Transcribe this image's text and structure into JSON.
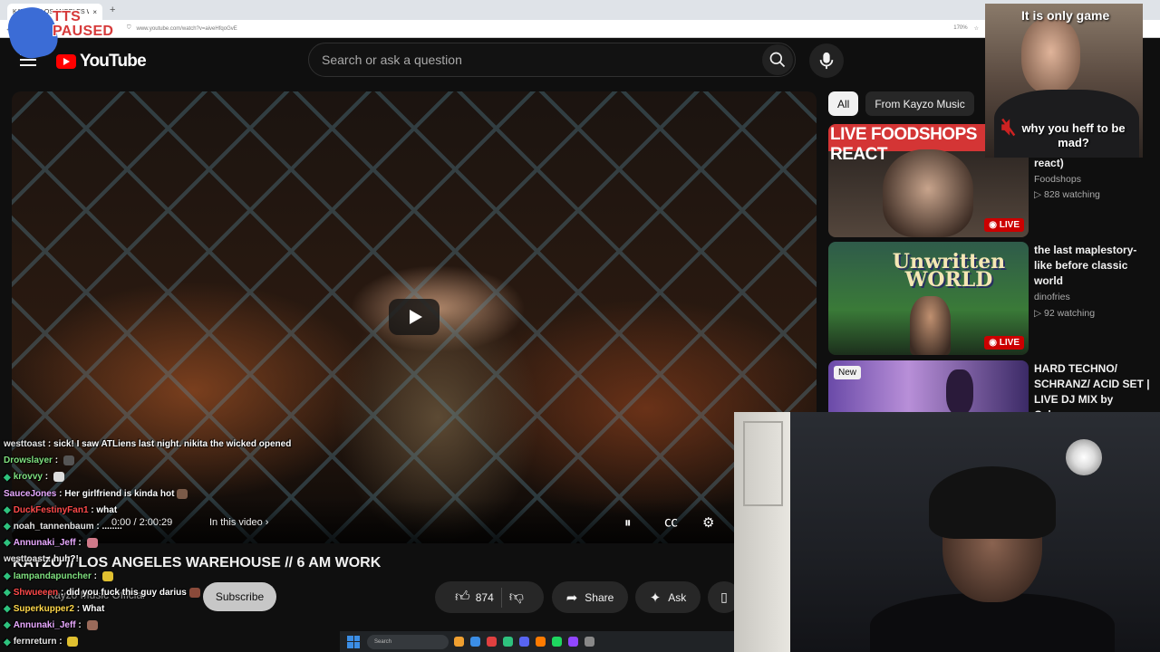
{
  "browser": {
    "tab_title": "KAYZO // LOS ANGELES WAREHOUSE",
    "tab_close": "×",
    "new_tab": "+",
    "url": "www.youtube.com/watch?v=aiveHfqoGvE",
    "zoom": "170%"
  },
  "tts": {
    "label_line1": "TTS",
    "label_line2": "PAUSED"
  },
  "header": {
    "logo_text": "YouTube",
    "search_placeholder": "Search or ask a question"
  },
  "player": {
    "time": "0:00 / 2:00:29",
    "chapter": "In this video",
    "chapter_chevron": "›"
  },
  "video": {
    "title": "KAYZO // LOS ANGELES WAREHOUSE // 6 AM WORK",
    "channel": "Kayzo Music Official",
    "subscribe_label": "Subscribe",
    "likes": "874",
    "share_label": "Share",
    "ask_label": "Ask"
  },
  "chips": [
    {
      "label": "All",
      "active": true
    },
    {
      "label": "From Kayzo Music",
      "active": false
    }
  ],
  "recommendations": [
    {
      "thumb_text": "LIVE FOODSHOPS REACT",
      "title": "react)",
      "channel": "Foodshops",
      "watching": "▷ 828 watching",
      "badge": "◉ LIVE"
    },
    {
      "thumb_text": "Unwritten WORLD",
      "title": "the last maplestory-like before classic world",
      "channel": "dinofries",
      "watching": "▷ 92 watching",
      "badge": "◉ LIVE"
    },
    {
      "title": "HARD TECHNO/ SCHRANZ/ ACID SET | LIVE DJ MIX by Cyber…",
      "badge": "New"
    }
  ],
  "webcam_top": {
    "caption_top": "It is only game",
    "caption_bottom": "why you heff to be mad?"
  },
  "chat": [
    {
      "user": "westtoast",
      "color": "#e5e5e5",
      "msg": "sick! I saw ATLiens last night. nikita the wicked opened",
      "badge": false
    },
    {
      "user": "Drowslayer",
      "color": "#7fe07f",
      "msg": "",
      "badge": false,
      "emote": "#555"
    },
    {
      "user": "krovvy",
      "color": "#7fe07f",
      "msg": "",
      "badge": true,
      "emote": "#ddd"
    },
    {
      "user": "SauceJones",
      "color": "#e8a9ff",
      "msg": "Her girlfriend is kinda hot",
      "badge": false,
      "emote": "#7a5a48"
    },
    {
      "user": "DuckFestinyFan1",
      "color": "#ff4a4a",
      "msg": "what",
      "badge": true
    },
    {
      "user": "noah_tannenbaum",
      "color": "#e5e5e5",
      "msg": "........",
      "badge": true
    },
    {
      "user": "Annunaki_Jeff",
      "color": "#e8a9ff",
      "msg": "",
      "badge": true,
      "emote": "#d07a8a"
    },
    {
      "user": "westtoast",
      "color": "#e5e5e5",
      "msg": "huh?!",
      "badge": false
    },
    {
      "user": "Iampandapuncher",
      "color": "#7fe07f",
      "msg": "",
      "badge": true,
      "emote": "#e0c030"
    },
    {
      "user": "Shwueeen",
      "color": "#ff4a4a",
      "msg": "did you fuck this guy darius",
      "badge": true,
      "emote": "#8a4a3a"
    },
    {
      "user": "Superkupper2",
      "color": "#ffd84a",
      "msg": "What",
      "badge": true
    },
    {
      "user": "Annunaki_Jeff",
      "color": "#e8a9ff",
      "msg": "",
      "badge": true,
      "emote": "#9a6a5a"
    },
    {
      "user": "fernreturn",
      "color": "#e5e5e5",
      "msg": "",
      "badge": true,
      "emote": "#e0c030"
    }
  ],
  "taskbar": {
    "search_label": "Search"
  }
}
